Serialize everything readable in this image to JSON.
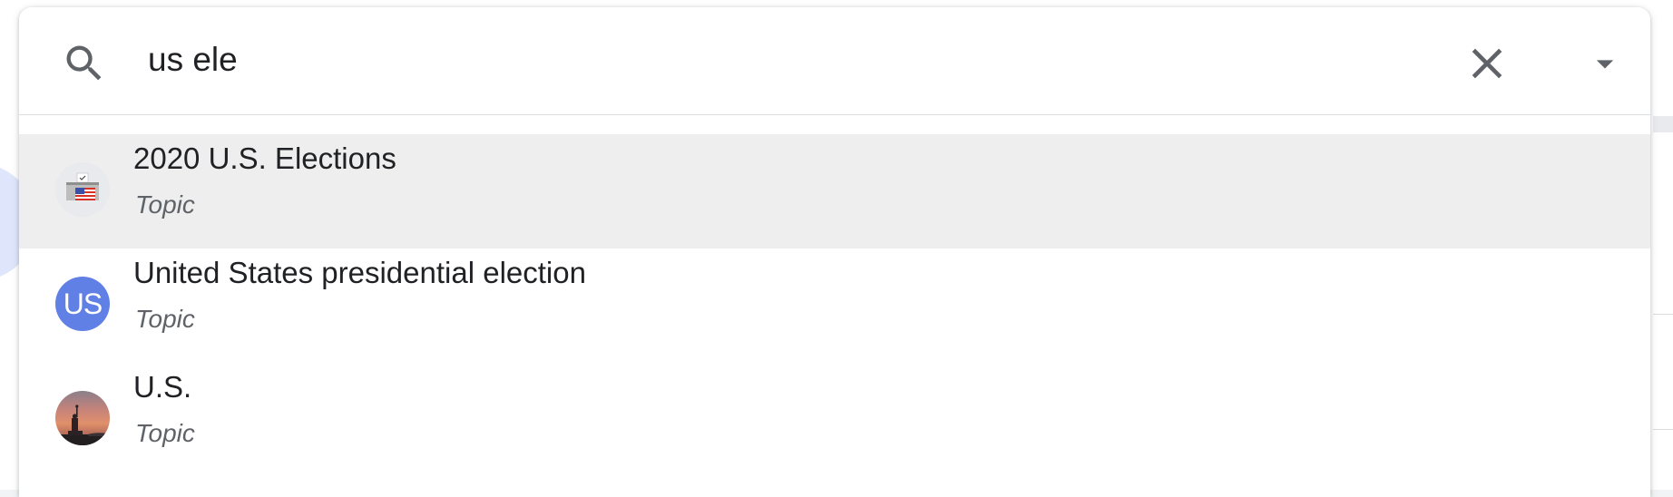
{
  "search": {
    "value": "us ele",
    "icon": "search-icon",
    "clear_icon": "close-icon",
    "dropdown_icon": "caret-down-icon"
  },
  "results": [
    {
      "title": "2020 U.S. Elections",
      "subtitle": "Topic",
      "avatar_icon": "ballot-box-icon",
      "selected": true
    },
    {
      "title": "United States presidential election",
      "subtitle": "Topic",
      "avatar_text": "US",
      "avatar_color": "#6180e6",
      "selected": false
    },
    {
      "title": "U.S.",
      "subtitle": "Topic",
      "avatar_icon": "statue-of-liberty-photo",
      "selected": false
    }
  ],
  "colors": {
    "text_primary": "#202124",
    "text_secondary": "#5f6368",
    "selected_row": "#eeeeee",
    "icon_gray": "#5f6368",
    "spell_underline": "#e06666"
  }
}
